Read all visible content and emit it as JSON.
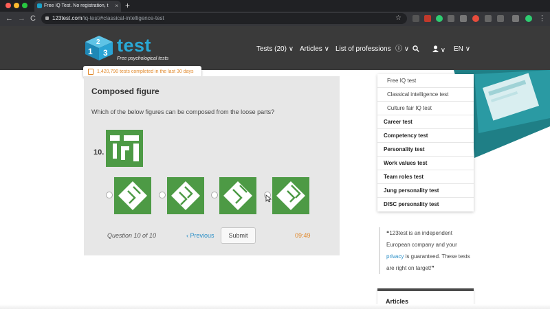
{
  "browser": {
    "tab_title": "Free IQ Test. No registration, t",
    "tab_close": "×",
    "new_tab": "+",
    "url_host": "123test.com",
    "url_path": "/iq-test/#classical-intelligence-test",
    "nav_back": "←",
    "nav_forward": "→",
    "nav_reload": "C",
    "bookmark_star": "☆",
    "menu_dots": "⋮",
    "colors": {
      "close": "#ff5f57",
      "minimize": "#febc2e",
      "maximize": "#28c840"
    }
  },
  "site": {
    "logo_text": "test",
    "logo_digits": [
      "1",
      "2",
      "3"
    ],
    "tagline": "Free psychological tests",
    "brand_color": "#29a9d6",
    "nav": {
      "tests": "Tests (20)",
      "articles": "Articles",
      "professions": "List of professions",
      "info_icon": "ⓘ",
      "user_icon": "user-icon",
      "language": "EN",
      "chevron": "∨"
    }
  },
  "badge": {
    "text": "1,420,790 tests completed in the last 30 days"
  },
  "test": {
    "title": "Composed figure",
    "question": "Which of the below figures can be composed from the loose parts?",
    "number": "10.",
    "progress": "Question 10 of 10",
    "previous": "‹ Previous",
    "submit": "Submit",
    "timer": "09:49",
    "tile_color": "#4d9a45",
    "options": [
      {
        "id": "option-1",
        "selected": false
      },
      {
        "id": "option-2",
        "selected": false
      },
      {
        "id": "option-3",
        "selected": false
      },
      {
        "id": "option-4",
        "selected": false
      }
    ]
  },
  "dropdown": {
    "items": [
      {
        "label": "Free IQ test",
        "kind": "sub"
      },
      {
        "label": "Classical intelligence test",
        "kind": "sub"
      },
      {
        "label": "Culture fair IQ test",
        "kind": "sub"
      },
      {
        "label": "Career test",
        "kind": "main"
      },
      {
        "label": "Competency test",
        "kind": "main"
      },
      {
        "label": "Personality test",
        "kind": "main"
      },
      {
        "label": "Work values test",
        "kind": "main"
      },
      {
        "label": "Team roles test",
        "kind": "main"
      },
      {
        "label": "Jung personality test",
        "kind": "main"
      },
      {
        "label": "DISC personality test",
        "kind": "main"
      }
    ]
  },
  "sidebar_quote": {
    "open_quote": "❝",
    "part1": "123test is an independent European company and your ",
    "link": "privacy",
    "part2": " is guaranteed. These tests are right on target!",
    "close_quote": "❞"
  },
  "articles_box": {
    "title": "Articles"
  }
}
